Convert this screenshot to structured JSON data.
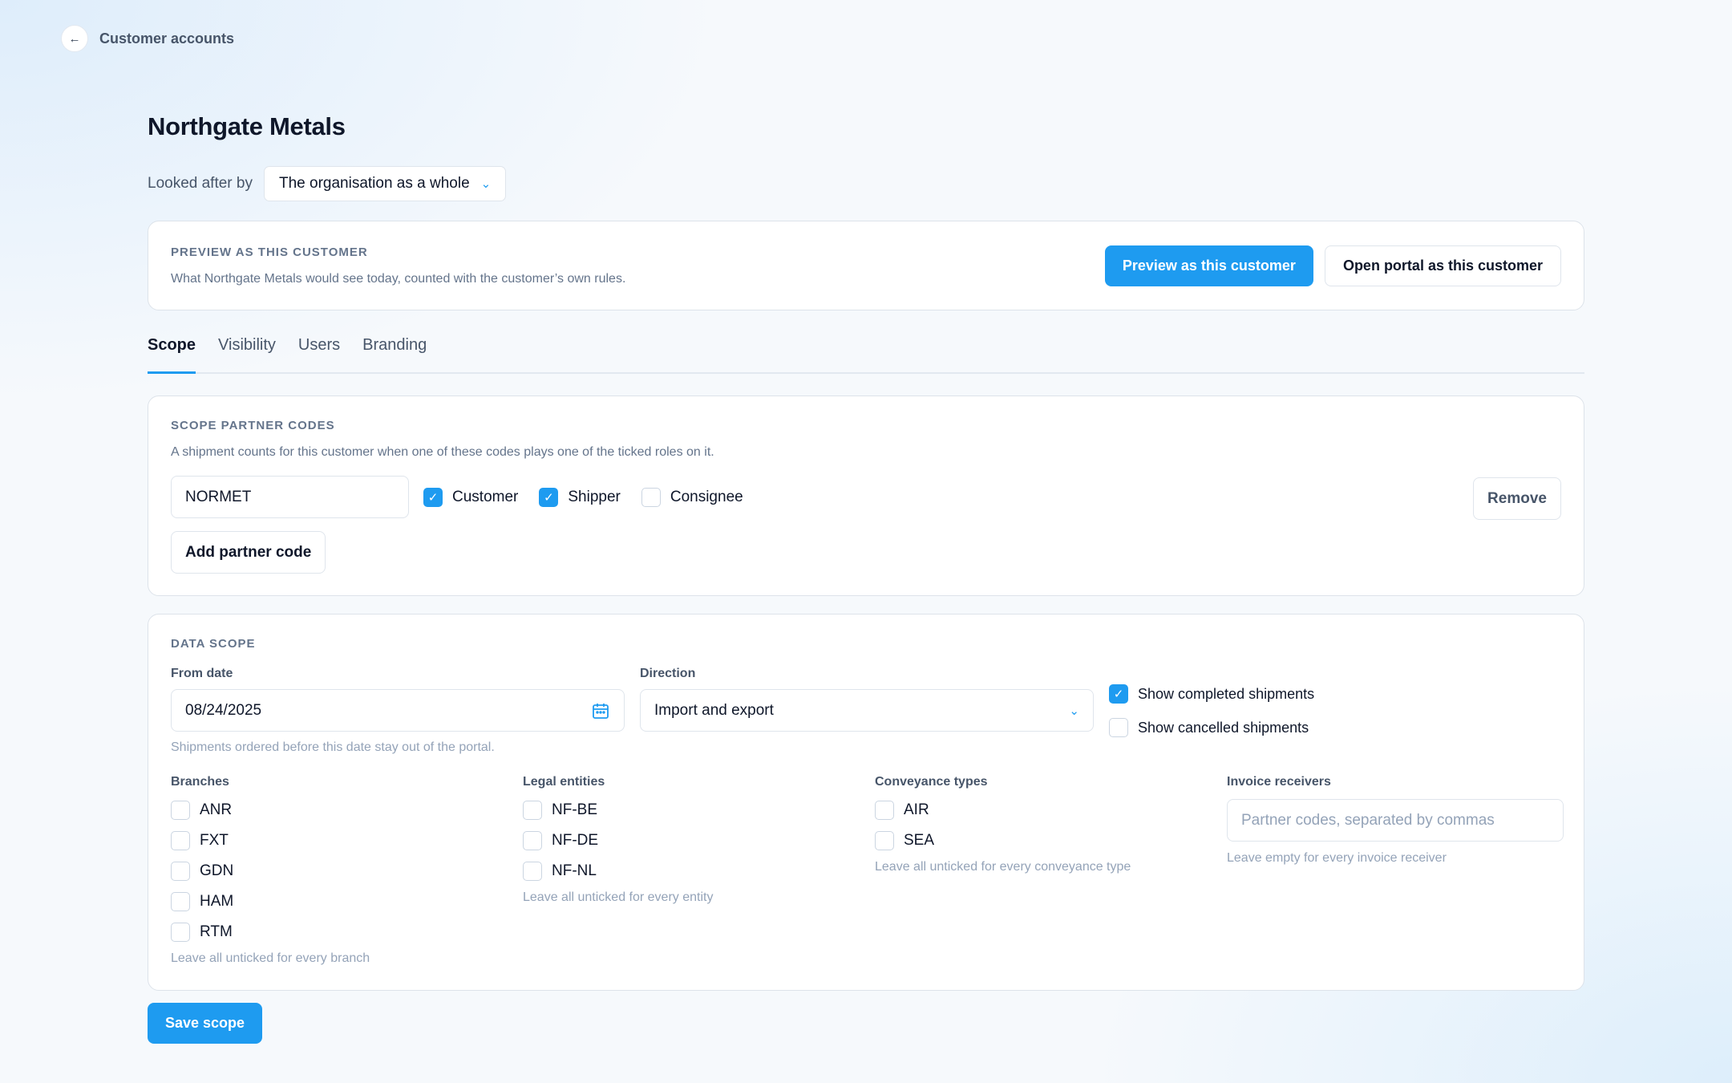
{
  "nav": {
    "back_label": "Customer accounts",
    "back_icon": "arrow-left-icon"
  },
  "page": {
    "title": "Northgate Metals",
    "looked_after_label": "Looked after by",
    "looked_after_value": "The organisation as a whole"
  },
  "preview": {
    "eyebrow": "PREVIEW AS THIS CUSTOMER",
    "description": "What Northgate Metals would see today, counted with the customer’s own rules.",
    "preview_button": "Preview as this customer",
    "portal_button": "Open portal as this customer"
  },
  "tabs": [
    {
      "label": "Scope",
      "active": true
    },
    {
      "label": "Visibility",
      "active": false
    },
    {
      "label": "Users",
      "active": false
    },
    {
      "label": "Branding",
      "active": false
    }
  ],
  "partner_codes": {
    "eyebrow": "SCOPE PARTNER CODES",
    "description": "A shipment counts for this customer when one of these codes plays one of the ticked roles on it.",
    "code_value": "NORMET",
    "roles": [
      {
        "label": "Customer",
        "checked": true
      },
      {
        "label": "Shipper",
        "checked": true
      },
      {
        "label": "Consignee",
        "checked": false
      }
    ],
    "remove_button": "Remove",
    "add_button": "Add partner code"
  },
  "data_scope": {
    "eyebrow": "DATA SCOPE",
    "from_date_label": "From date",
    "from_date_value": "08/24/2025",
    "from_date_hint": "Shipments ordered before this date stay out of the portal.",
    "direction_label": "Direction",
    "direction_value": "Import and export",
    "show_completed": {
      "label": "Show completed shipments",
      "checked": true
    },
    "show_cancelled": {
      "label": "Show cancelled shipments",
      "checked": false
    },
    "branches": {
      "label": "Branches",
      "items": [
        "ANR",
        "FXT",
        "GDN",
        "HAM",
        "RTM"
      ],
      "hint": "Leave all unticked for every branch"
    },
    "legal_entities": {
      "label": "Legal entities",
      "items": [
        "NF-BE",
        "NF-DE",
        "NF-NL"
      ],
      "hint": "Leave all unticked for every entity"
    },
    "conveyance_types": {
      "label": "Conveyance types",
      "items": [
        "AIR",
        "SEA"
      ],
      "hint": "Leave all unticked for every conveyance type"
    },
    "invoice_receivers": {
      "label": "Invoice receivers",
      "placeholder": "Partner codes, separated by commas",
      "hint": "Leave empty for every invoice receiver"
    }
  },
  "save_button": "Save scope",
  "colors": {
    "accent": "#1e9bf0",
    "text": "#0f172a",
    "muted": "#64748b"
  }
}
